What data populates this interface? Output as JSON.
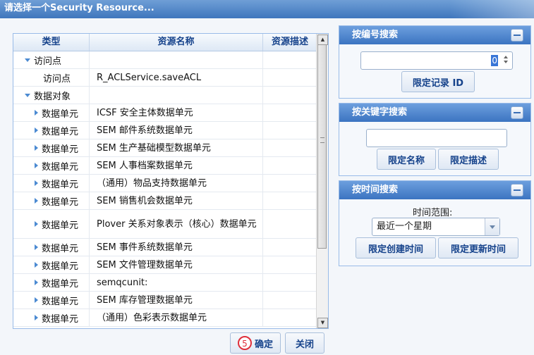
{
  "window": {
    "title": "请选择一个Security Resource..."
  },
  "grid": {
    "columns": [
      "类型",
      "资源名称",
      "资源描述"
    ],
    "rows": [
      {
        "type": "访问点",
        "name": "",
        "desc": "",
        "level": 0,
        "expander": "down"
      },
      {
        "type": "访问点",
        "name": "R_ACLService.saveACL",
        "desc": "",
        "level": 1,
        "expander": "none"
      },
      {
        "type": "数据对象",
        "name": "",
        "desc": "",
        "level": 0,
        "expander": "down"
      },
      {
        "type": "数据单元",
        "name": "ICSF 安全主体数据单元",
        "desc": "",
        "level": 1,
        "expander": "right"
      },
      {
        "type": "数据单元",
        "name": "SEM 邮件系统数据单元",
        "desc": "",
        "level": 1,
        "expander": "right"
      },
      {
        "type": "数据单元",
        "name": "SEM 生产基础模型数据单元",
        "desc": "",
        "level": 1,
        "expander": "right"
      },
      {
        "type": "数据单元",
        "name": "SEM 人事档案数据单元",
        "desc": "",
        "level": 1,
        "expander": "right"
      },
      {
        "type": "数据单元",
        "name": "（通用）物品支持数据单元",
        "desc": "",
        "level": 1,
        "expander": "right"
      },
      {
        "type": "数据单元",
        "name": "SEM 销售机会数据单元",
        "desc": "",
        "level": 1,
        "expander": "right"
      },
      {
        "type": "数据单元",
        "name": "Plover 关系对象表示（核心）数据单元",
        "desc": "",
        "level": 1,
        "expander": "right",
        "tall": true
      },
      {
        "type": "数据单元",
        "name": "SEM 事件系统数据单元",
        "desc": "",
        "level": 1,
        "expander": "right"
      },
      {
        "type": "数据单元",
        "name": "SEM 文件管理数据单元",
        "desc": "",
        "level": 1,
        "expander": "right"
      },
      {
        "type": "数据单元",
        "name": "semqcunit:",
        "desc": "",
        "level": 1,
        "expander": "right"
      },
      {
        "type": "数据单元",
        "name": "SEM 库存管理数据单元",
        "desc": "",
        "level": 1,
        "expander": "right"
      },
      {
        "type": "数据单元",
        "name": "（通用）色彩表示数据单元",
        "desc": "",
        "level": 1,
        "expander": "right"
      }
    ]
  },
  "footer": {
    "step_number": "5",
    "confirm_label": "确定",
    "close_label": "关闭"
  },
  "panels": {
    "by_id": {
      "title": "按编号搜索",
      "value": "0",
      "button": "限定记录 ID"
    },
    "by_keyword": {
      "title": "按关键字搜索",
      "value": "",
      "button_name": "限定名称",
      "button_desc": "限定描述"
    },
    "by_time": {
      "title": "按时间搜索",
      "range_label": "时间范围:",
      "range_value": "最近一个星期",
      "button_created": "限定创建时间",
      "button_updated": "限定更新时间"
    }
  },
  "colors": {
    "header_blue": "#3b74c1",
    "accent_text": "#15428b",
    "step_red": "#e0303b"
  }
}
